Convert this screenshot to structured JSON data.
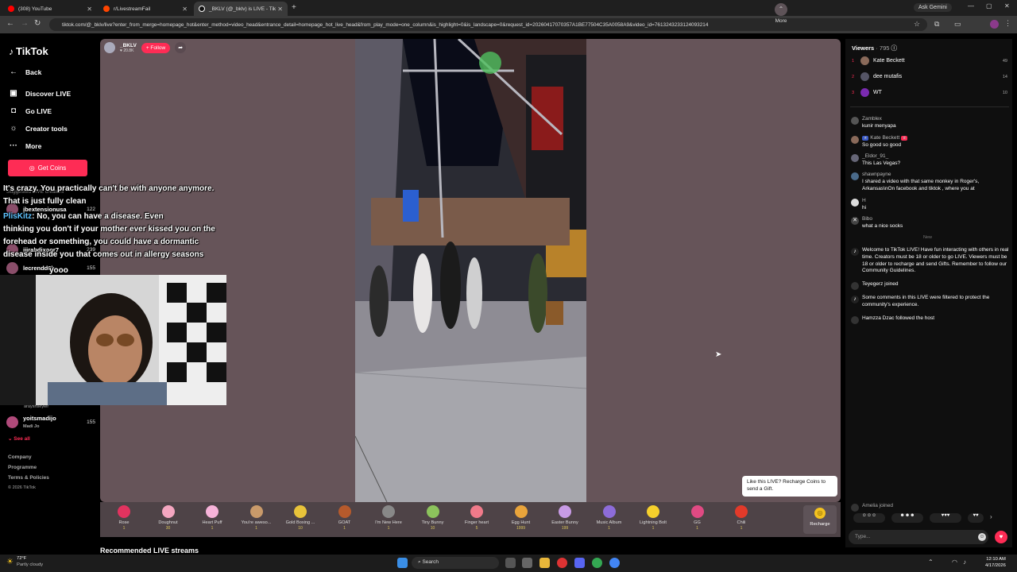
{
  "browser": {
    "tabs": [
      {
        "title": "(308) YouTube"
      },
      {
        "title": "r/LivestreamFail"
      },
      {
        "title": "_BKLV (@_bklv) is LIVE - Tik"
      }
    ],
    "gemini_label": "Ask Gemini",
    "url": "tiktok.com/@_bklv/live?enter_from_merge=homepage_hot&enter_method=video_head&entrance_detail=homepage_hot_live_head&from_play_mode=one_column&is_highlight=0&is_landscape=0&request_id=20260417070357A1BE77504C35A0058A9&video_id=7613243233124093214"
  },
  "sidebar": {
    "logo": "TikTok",
    "back": "Back",
    "items": [
      {
        "label": "Discover LIVE",
        "icon": "tv-icon"
      },
      {
        "label": "Go LIVE",
        "icon": "camera-icon"
      },
      {
        "label": "Creator tools",
        "icon": "lightbulb-icon"
      },
      {
        "label": "More",
        "icon": "dots-icon"
      }
    ],
    "get_coins": "Get Coins",
    "suggested_heading": "Suggested LIVE creators",
    "suggested": [
      {
        "name": "jbextensionusa",
        "sub": "",
        "count": "122"
      },
      {
        "name": "jiirabdixoor7",
        "sub": "",
        "count": "239"
      },
      {
        "name": "lecrendd6k",
        "sub": "",
        "count": "155"
      },
      {
        "name": "yoitsmadijo",
        "sub": "Madi Jo",
        "count": "155"
      }
    ],
    "partial_name": "arayshseyler",
    "see_all": "See all",
    "footer": [
      "Company",
      "Programme",
      "Terms & Policies",
      "© 2026 TikTok"
    ]
  },
  "host": {
    "name": "_BKLV",
    "likes": "20.8K",
    "follow": "+ Follow"
  },
  "captions": [
    "It's crazy. You practically can't be with anyone anymore.",
    "That is just fully clean",
    "PlisKitz",
    ": No, you can have a disease. Even",
    "thinking you don't if your mother ever kissed you on the",
    "forehead or something, you could have a dormantic",
    "disease inside you that comes out in allergy seasons",
    "yooo"
  ],
  "gifts": [
    {
      "name": "Rose",
      "price": "1",
      "color": "#e2335f"
    },
    {
      "name": "Doughnut",
      "price": "30",
      "color": "#f4a6c0"
    },
    {
      "name": "Heart Puff",
      "price": "1",
      "color": "#f7b3d9"
    },
    {
      "name": "You're aweso...",
      "price": "1",
      "color": "#c99a6a"
    },
    {
      "name": "Gold Boxing ...",
      "price": "10",
      "color": "#e8c33a"
    },
    {
      "name": "GOAT",
      "price": "1",
      "color": "#b65a2c"
    },
    {
      "name": "I'm New Here",
      "price": "1",
      "color": "#888888"
    },
    {
      "name": "Tiny Bunny",
      "price": "10",
      "color": "#8cc35c"
    },
    {
      "name": "Finger heart",
      "price": "5",
      "color": "#f07a8a"
    },
    {
      "name": "Egg Hunt",
      "price": "1999",
      "color": "#e9a43b"
    },
    {
      "name": "Easter Bunny",
      "price": "199",
      "color": "#c89be6"
    },
    {
      "name": "Music Album",
      "price": "1",
      "color": "#8d6cd9"
    },
    {
      "name": "Lightning Bolt",
      "price": "1",
      "color": "#f6d02c"
    },
    {
      "name": "GG",
      "price": "1",
      "color": "#e04a83"
    },
    {
      "name": "Chili",
      "price": "1",
      "color": "#e23a2a"
    }
  ],
  "gift_more": "More",
  "recharge": "Recharge",
  "like_card": "Like this LIVE? Recharge Coins to send a Gift.",
  "recommended": "Recommended LIVE streams",
  "viewers": {
    "title": "Viewers",
    "count": "795",
    "list": [
      {
        "rank": "1",
        "name": "Kate Beckett",
        "score": "49"
      },
      {
        "rank": "2",
        "name": "dee mutafis",
        "score": "14"
      },
      {
        "rank": "3",
        "name": "WT",
        "score": "10"
      }
    ]
  },
  "chat": [
    {
      "user": "Zamblex",
      "text": "kunir menyapa"
    },
    {
      "user": "Kate Beckett",
      "text": "So good so good"
    },
    {
      "user": "_Eldor_91_",
      "text": "This Las Vegas?"
    },
    {
      "user": "shawnpayne",
      "text": "I shared a video with that same monkey in Roger's, Arkansas\\nOn facebook and tiktok , where you at"
    },
    {
      "user": "H",
      "text": "hi"
    },
    {
      "user": "Bibo",
      "text": "what a nice socks"
    }
  ],
  "new_label": "New",
  "system_messages": [
    "Welcome to TikTok LIVE! Have fun interacting with others in real time. Creators must be 18 or older to go LIVE. Viewers must be 18 or older to recharge and send Gifts. Remember to follow our Community Guidelines.",
    "Teyegerz joined",
    "Some comments in this LIVE were filtered to protect the community's experience.",
    "Hamzza Dzac followed the host"
  ],
  "last_join": "Amelia joined",
  "type_placeholder": "Type...",
  "taskbar": {
    "weather_temp": "72°F",
    "weather_desc": "Partly cloudy",
    "search": "Search",
    "time": "12:10 AM",
    "date": "4/17/2026"
  }
}
